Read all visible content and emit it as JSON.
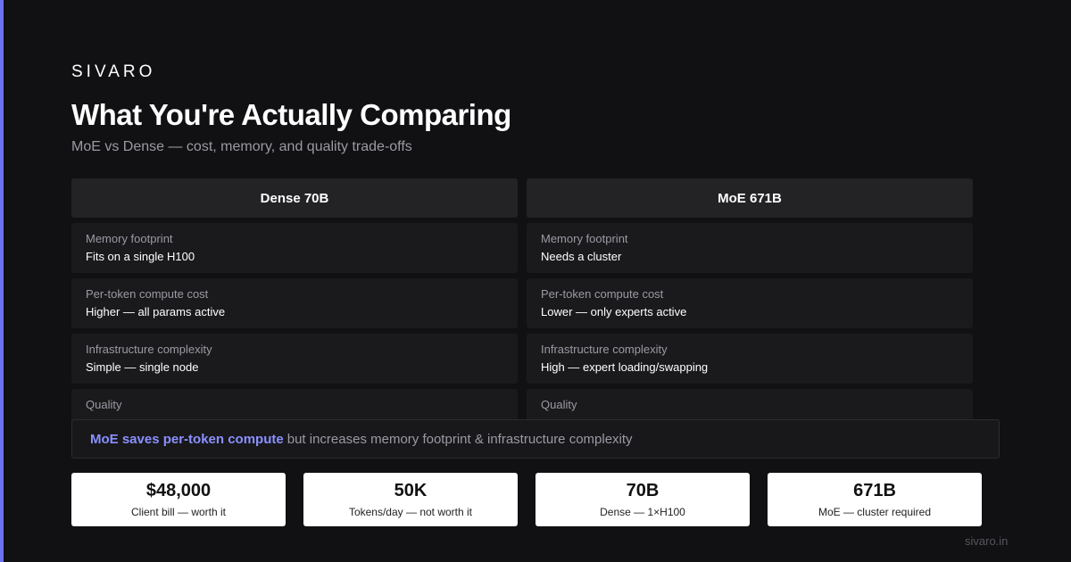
{
  "brand": "SIVARO",
  "title": "What You're Actually Comparing",
  "subtitle": "MoE vs Dense — cost, memory, and quality trade-offs",
  "comparison": {
    "dense": {
      "header": "Dense 70B",
      "rows": [
        {
          "label": "Memory footprint",
          "value": "Fits on a single H100"
        },
        {
          "label": "Per-token compute cost",
          "value": "Higher — all params active"
        },
        {
          "label": "Infrastructure complexity",
          "value": "Simple — single node"
        },
        {
          "label": "Quality",
          "value": ""
        }
      ]
    },
    "moe": {
      "header": "MoE 671B",
      "rows": [
        {
          "label": "Memory footprint",
          "value": "Needs a cluster"
        },
        {
          "label": "Per-token compute cost",
          "value": "Lower — only experts active"
        },
        {
          "label": "Infrastructure complexity",
          "value": "High — expert loading/swapping"
        },
        {
          "label": "Quality",
          "value": ""
        }
      ]
    }
  },
  "callout": {
    "highlight": "MoE saves per-token compute",
    "rest": "but increases memory footprint & infrastructure complexity"
  },
  "stats": [
    {
      "value": "$48,000",
      "label": "Client bill — worth it"
    },
    {
      "value": "50K",
      "label": "Tokens/day — not worth it"
    },
    {
      "value": "70B",
      "label": "Dense — 1×H100"
    },
    {
      "value": "671B",
      "label": "MoE — cluster required"
    }
  ],
  "footer": {
    "url": "sivaro.in"
  },
  "colors": {
    "background": "#111113",
    "accent": "#6c72f0",
    "highlight": "#8b90ff",
    "card": "#ffffff"
  }
}
